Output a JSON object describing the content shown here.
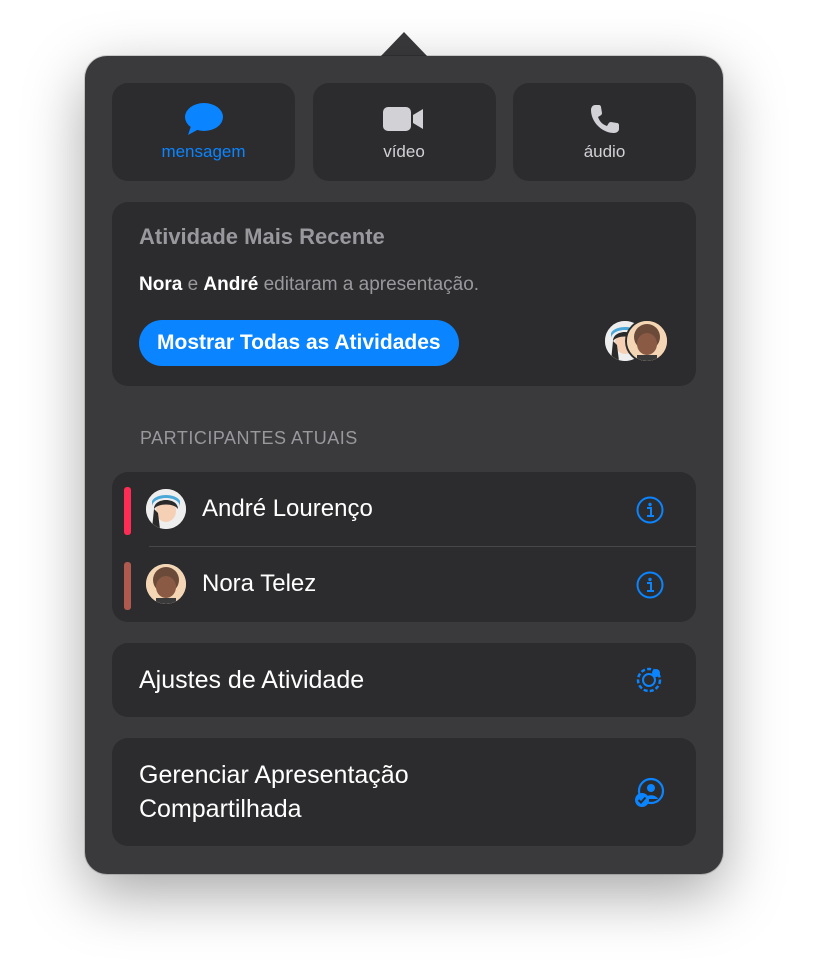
{
  "actions": [
    {
      "label": "mensagem",
      "icon": "message-bubble-icon",
      "active": true
    },
    {
      "label": "vídeo",
      "icon": "video-camera-icon",
      "active": false
    },
    {
      "label": "áudio",
      "icon": "phone-icon",
      "active": false
    }
  ],
  "recent": {
    "title": "Atividade Mais Recente",
    "name1": "Nora",
    "conj": " e ",
    "name2": "André",
    "rest": " editaram a apresentação.",
    "button": "Mostrar Todas as Atividades"
  },
  "participants": {
    "header": "PARTICIPANTES ATUAIS",
    "list": [
      {
        "name": "André Lourenço",
        "color": "#ff2d55"
      },
      {
        "name": "Nora Telez",
        "color": "#b0594f"
      }
    ]
  },
  "settings": {
    "activity_label": "Ajustes de Atividade",
    "manage_line1": "Gerenciar Apresentação",
    "manage_line2": "Compartilhada"
  },
  "colors": {
    "accent": "#0a84ff",
    "panel": "#3a3a3c",
    "card": "#2c2c2e"
  }
}
